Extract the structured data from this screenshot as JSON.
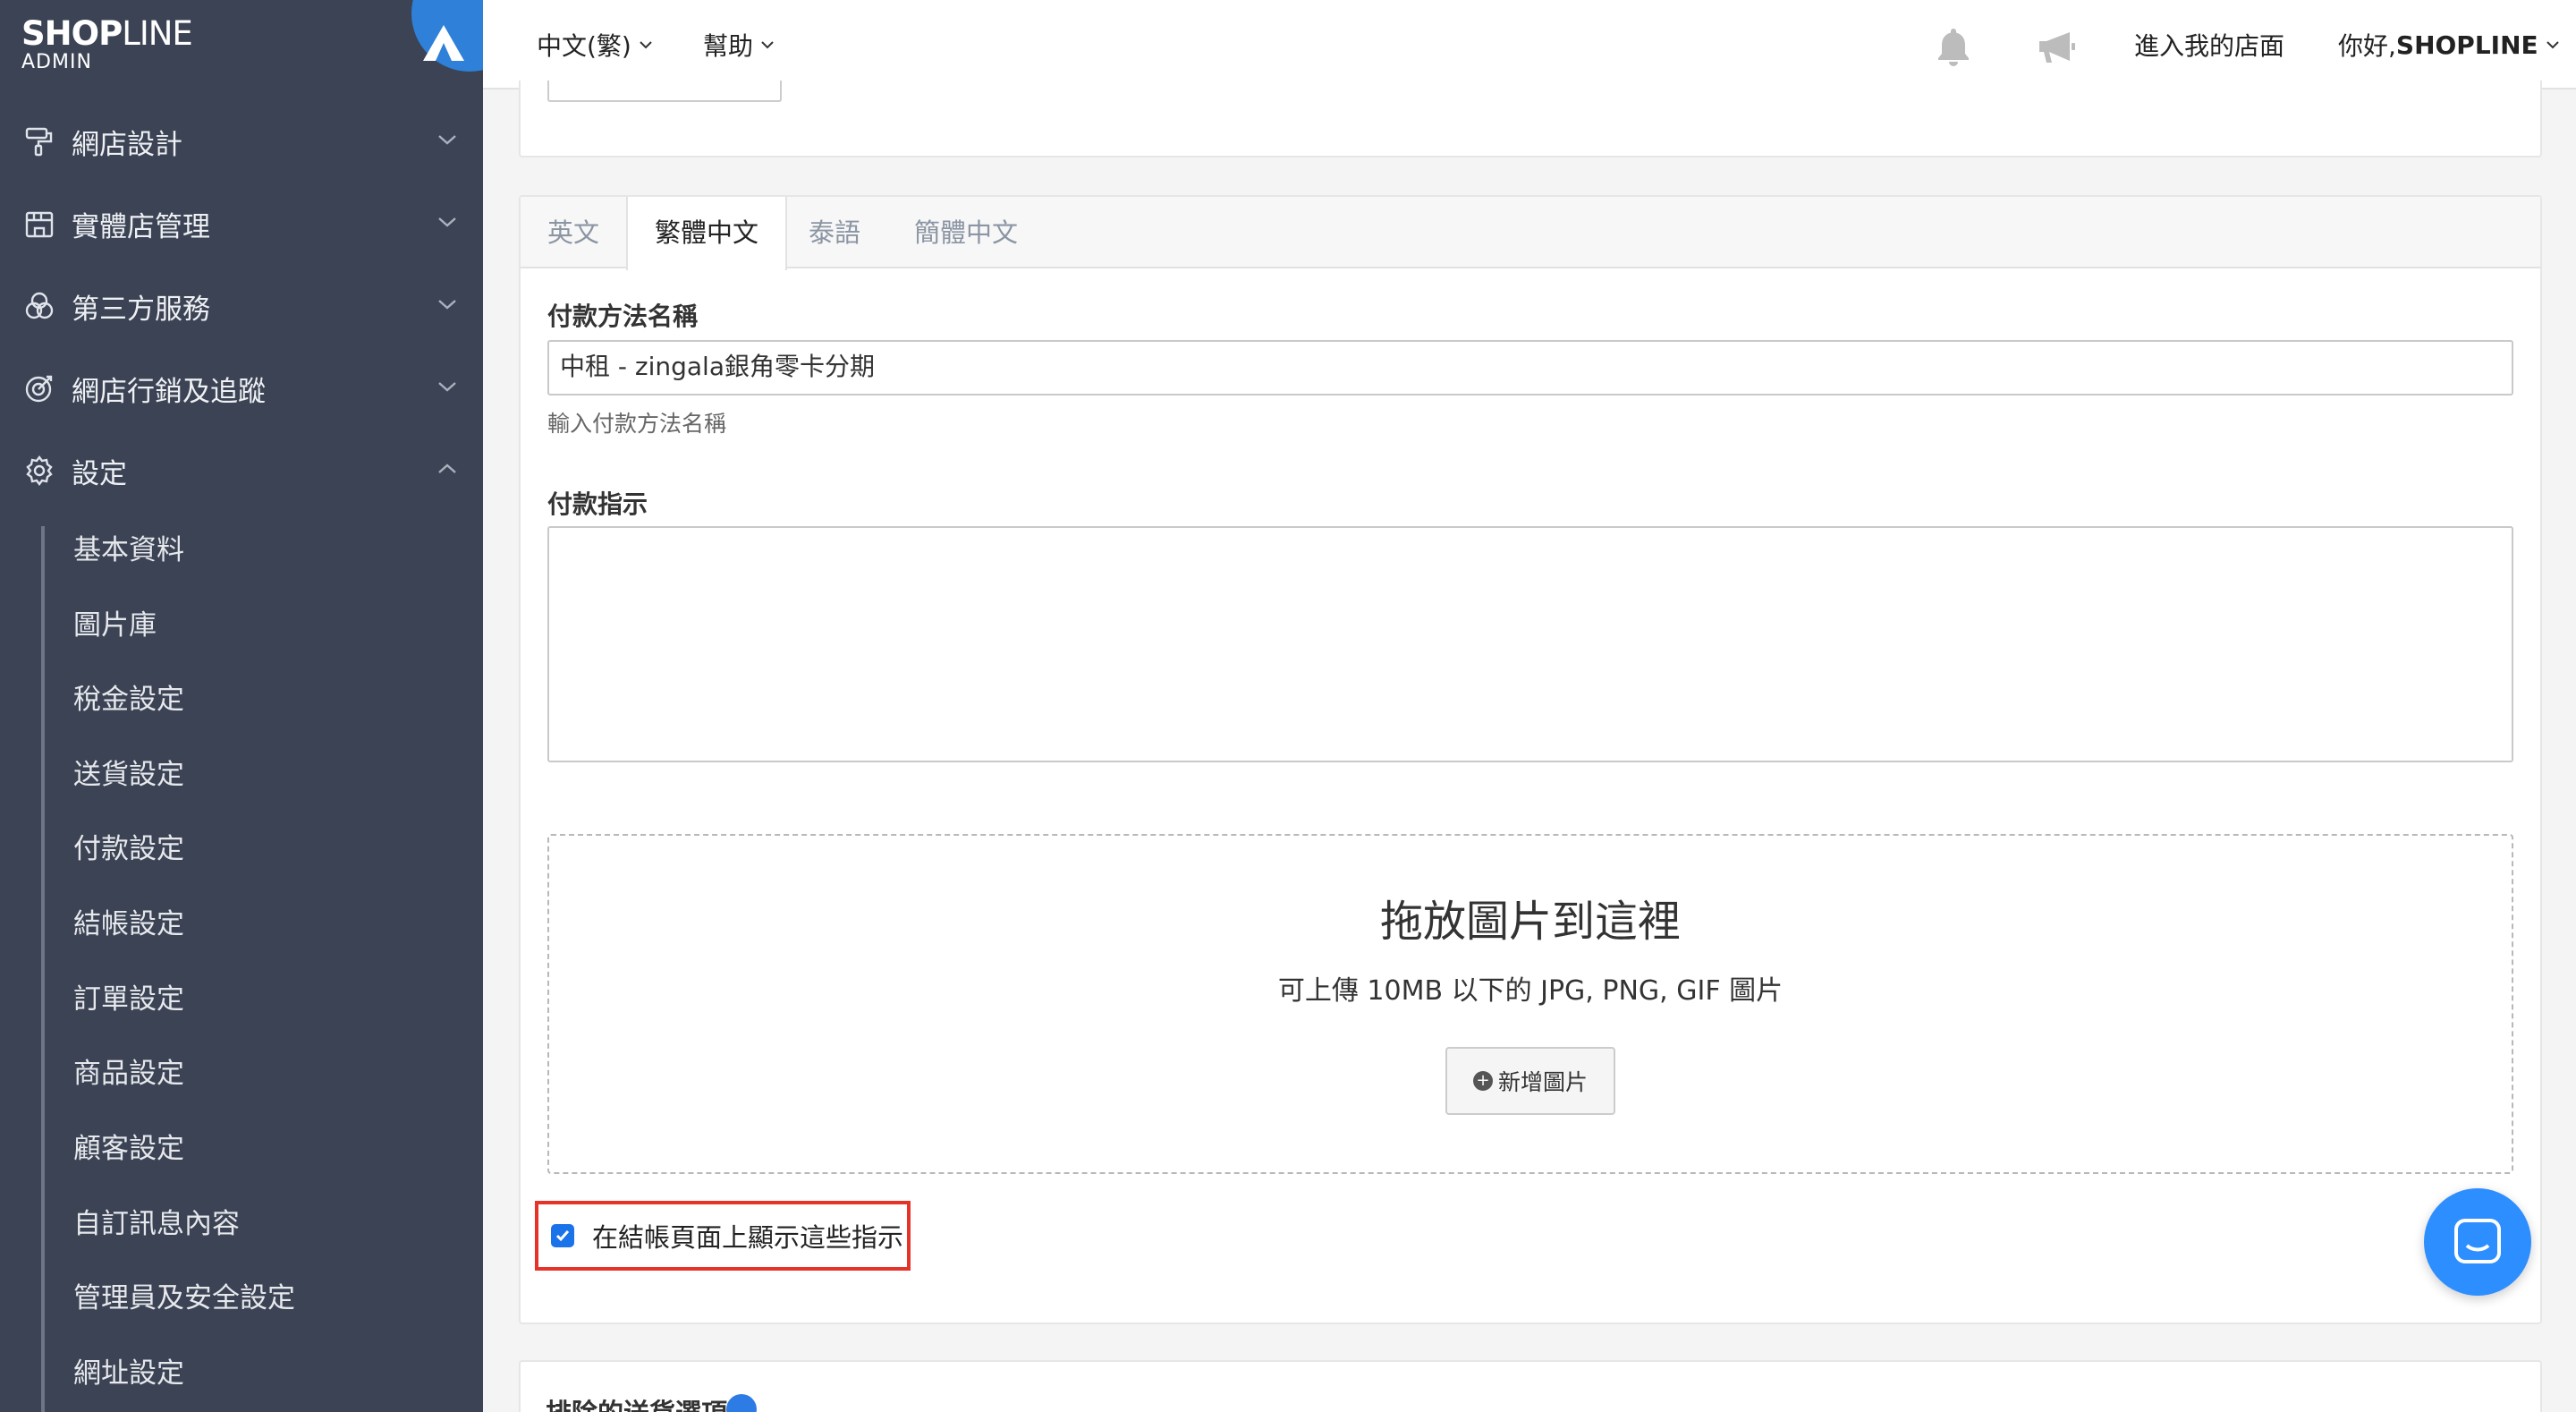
{
  "sidebar": {
    "logo_brand": "SHOPLINE",
    "logo_brand_a": "SH",
    "logo_brand_b": "P",
    "logo_brand_c": "LINE",
    "logo_sub": "ADMIN",
    "sections": [
      {
        "label": "網店設計",
        "icon": "paint-roller-icon",
        "expanded": false
      },
      {
        "label": "實體店管理",
        "icon": "store-icon",
        "expanded": false
      },
      {
        "label": "第三方服務",
        "icon": "circles-icon",
        "expanded": false
      },
      {
        "label": "網店行銷及追蹤",
        "icon": "target-icon",
        "expanded": false
      },
      {
        "label": "設定",
        "icon": "gear-icon",
        "expanded": true
      }
    ],
    "settings_items": [
      "基本資料",
      "圖片庫",
      "稅金設定",
      "送貨設定",
      "付款設定",
      "結帳設定",
      "訂單設定",
      "商品設定",
      "顧客設定",
      "自訂訊息內容",
      "管理員及安全設定",
      "網址設定"
    ]
  },
  "topbar": {
    "language": "中文(繁)",
    "help": "幫助",
    "enter_store": "進入我的店面",
    "greeting": "你好, ",
    "user": "SHOPLINE"
  },
  "tabs": {
    "items": [
      "英文",
      "繁體中文",
      "泰語",
      "簡體中文"
    ],
    "active": "繁體中文"
  },
  "form": {
    "name_label": "付款方法名稱",
    "name_value": "中租 - zingala銀角零卡分期",
    "name_help": "輸入付款方法名稱",
    "instructions_label": "付款指示",
    "instructions_value": ""
  },
  "dropzone": {
    "title": "拖放圖片到這裡",
    "subtitle": "可上傳 10MB 以下的 JPG, PNG, GIF 圖片",
    "button": "新增圖片"
  },
  "checkbox": {
    "label": "在結帳頁面上顯示這些指示",
    "checked": true
  },
  "next_section": {
    "label": "排除的送貨選項"
  },
  "colors": {
    "sidebar_bg": "#3b4354",
    "accent": "#2f80d8",
    "highlight": "#e5332a",
    "chat": "#2d8eff"
  }
}
